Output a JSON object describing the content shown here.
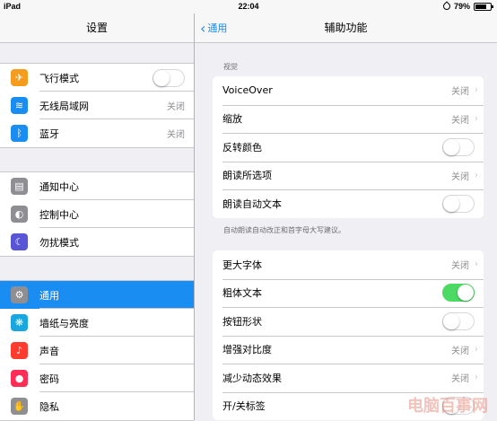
{
  "status_bar": {
    "device": "iPad",
    "time": "22:04",
    "battery": "79%",
    "battery_level": 0.79
  },
  "left": {
    "title": "设置",
    "groups": [
      {
        "items": [
          {
            "icon": "airplane-icon",
            "icon_color": "#f59b1e",
            "glyph": "✈",
            "label": "飞行模式",
            "control": "toggle",
            "on": false
          },
          {
            "icon": "wifi-icon",
            "icon_color": "#1a8df2",
            "glyph": "≋",
            "label": "无线局域网",
            "value": "关闭"
          },
          {
            "icon": "bluetooth-icon",
            "icon_color": "#1a8df2",
            "glyph": "ᛒ",
            "label": "蓝牙",
            "value": "关闭"
          }
        ]
      },
      {
        "items": [
          {
            "icon": "notification-center-icon",
            "icon_color": "#8e8e93",
            "glyph": "▤",
            "label": "通知中心"
          },
          {
            "icon": "control-center-icon",
            "icon_color": "#8e8e93",
            "glyph": "◐",
            "label": "控制中心"
          },
          {
            "icon": "do-not-disturb-icon",
            "icon_color": "#5856d6",
            "glyph": "☾",
            "label": "勿扰模式"
          }
        ]
      },
      {
        "items": [
          {
            "icon": "general-gear-icon",
            "icon_color": "#8e8e93",
            "glyph": "⚙",
            "label": "通用",
            "selected": true
          },
          {
            "icon": "wallpaper-brightness-icon",
            "icon_color": "#1aa7e0",
            "glyph": "❋",
            "label": "墙纸与亮度"
          },
          {
            "icon": "sounds-icon",
            "icon_color": "#ff3b30",
            "glyph": "♪",
            "label": "声音"
          },
          {
            "icon": "passcode-lock-icon",
            "icon_color": "#ff2d55",
            "glyph": "●",
            "label": "密码"
          },
          {
            "icon": "privacy-hand-icon",
            "icon_color": "#8e8e93",
            "glyph": "✋",
            "label": "隐私"
          }
        ]
      }
    ]
  },
  "right": {
    "back_label": "通用",
    "title": "辅助功能",
    "sections": [
      {
        "header": "视觉",
        "rows": [
          {
            "label": "VoiceOver",
            "value": "关闭",
            "chevron": true
          },
          {
            "label": "缩放",
            "value": "关闭",
            "chevron": true
          },
          {
            "label": "反转颜色",
            "control": "toggle",
            "on": false
          },
          {
            "label": "朗读所选项",
            "value": "关闭",
            "chevron": true
          },
          {
            "label": "朗读自动文本",
            "control": "toggle",
            "on": false
          }
        ],
        "footer": "自动朗读自动改正和首字母大写建议。"
      },
      {
        "header": "",
        "rows": [
          {
            "label": "更大字体",
            "value": "关闭",
            "chevron": true
          },
          {
            "label": "粗体文本",
            "control": "toggle",
            "on": true
          },
          {
            "label": "按钮形状",
            "control": "toggle",
            "on": false
          },
          {
            "label": "增强对比度",
            "value": "关闭",
            "chevron": true
          },
          {
            "label": "减少动态效果",
            "value": "关闭",
            "chevron": true
          },
          {
            "label": "开/关标签",
            "control": "toggle",
            "on": false
          }
        ]
      }
    ]
  },
  "watermark": "电脑百事网"
}
